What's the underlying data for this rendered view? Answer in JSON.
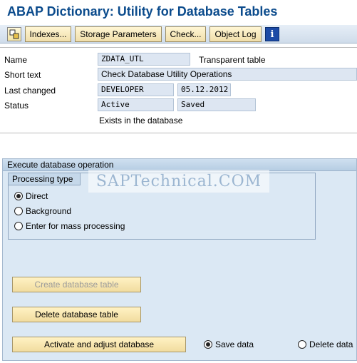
{
  "window_title": "ABAP Dictionary: Utility for Database Tables",
  "toolbar": {
    "icon_execute": "execute-icon",
    "buttons": [
      "Indexes...",
      "Storage Parameters",
      "Check...",
      "Object Log"
    ],
    "icon_info": "info-icon"
  },
  "fields": {
    "name_label": "Name",
    "name_value": "ZDATA_UTL",
    "table_type": "Transparent table",
    "short_text_label": "Short text",
    "short_text_value": "Check Database Utility Operations",
    "last_changed_label": "Last changed",
    "last_changed_user": "DEVELOPER",
    "last_changed_date": "05.12.2012",
    "status_label": "Status",
    "status_value": "Active",
    "status_saved": "Saved",
    "db_status": "Exists in the database"
  },
  "execute_section": {
    "title": "Execute database operation",
    "processing_type": {
      "title": "Processing type",
      "options": [
        {
          "label": "Direct",
          "selected": true
        },
        {
          "label": "Background",
          "selected": false
        },
        {
          "label": "Enter for mass processing",
          "selected": false
        }
      ]
    },
    "buttons": {
      "create": "Create database table",
      "delete": "Delete database table",
      "activate": "Activate and adjust database"
    },
    "data_options": [
      {
        "label": "Save data",
        "selected": true
      },
      {
        "label": "Delete data",
        "selected": false
      }
    ]
  },
  "watermark": "SAPTechnical.COM",
  "colors": {
    "title": "#0b4b8c",
    "field_bg": "#dde6f2",
    "section_bg": "#dbe8f4",
    "button_bg": "#f0deaa"
  }
}
